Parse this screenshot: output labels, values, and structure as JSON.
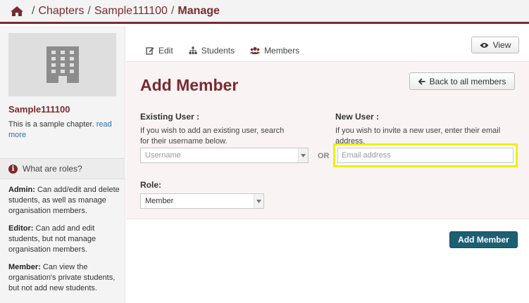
{
  "breadcrumb": {
    "chapters": "Chapters",
    "chapter": "Sample111100",
    "current": "Manage"
  },
  "sidebar": {
    "org_name": "Sample111100",
    "org_desc": "This is a sample chapter.",
    "read_more": "read more",
    "roles_title": "What are roles?",
    "roles": [
      {
        "name": "Admin:",
        "desc": "Can add/edit and delete students, as well as manage organisation members."
      },
      {
        "name": "Editor:",
        "desc": "Can add and edit students, but not manage organisation members."
      },
      {
        "name": "Member:",
        "desc": "Can view the organisation's private students, but not add new students."
      }
    ]
  },
  "tabs": {
    "edit": "Edit",
    "students": "Students",
    "members": "Members"
  },
  "view_button": "View",
  "form": {
    "title": "Add Member",
    "back_button": "Back to all members",
    "existing_label": "Existing User :",
    "existing_help": "If you wish to add an existing user, search for their username below.",
    "username_placeholder": "Username",
    "or": "OR",
    "new_label": "New User :",
    "new_help": "If you wish to invite a new user, enter their email address.",
    "email_placeholder": "Email address",
    "role_label": "Role:",
    "role_value": "Member",
    "submit": "Add Member"
  },
  "colors": {
    "brand": "#7b2a30",
    "primary_button": "#1d5f73",
    "highlight": "#f0f000"
  }
}
